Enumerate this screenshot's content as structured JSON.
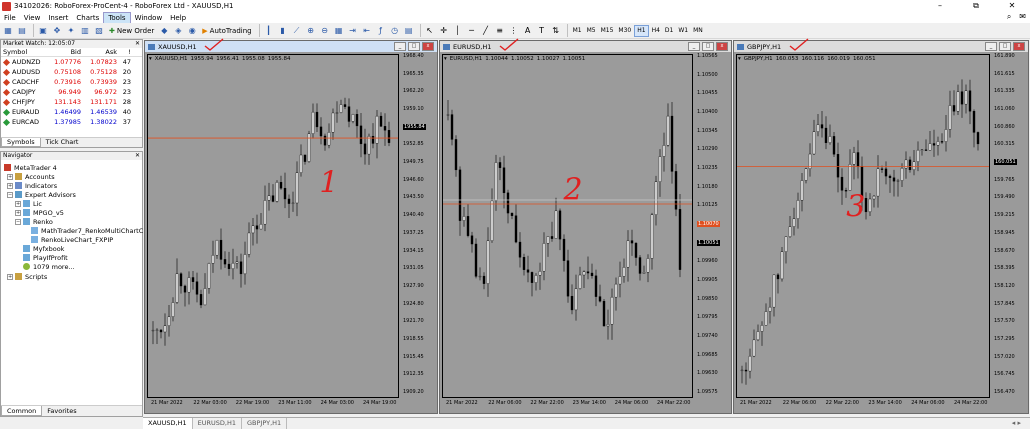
{
  "window": {
    "title": "34102026: RoboForex-ProCent-4 - RoboForex Ltd - XAUUSD,H1",
    "min_label": "–",
    "max_label": "⧉",
    "close_label": "✕"
  },
  "menu": [
    "File",
    "View",
    "Insert",
    "Charts",
    "Tools",
    "Window",
    "Help"
  ],
  "menu_active": "Tools",
  "toolbar": {
    "new_order": "New Order",
    "autotrading": "AutoTrading",
    "timeframes": [
      "M1",
      "M5",
      "M15",
      "M30",
      "H1",
      "H4",
      "D1",
      "W1",
      "MN"
    ],
    "active_timeframe": "H1"
  },
  "market_watch": {
    "title": "Market Watch: 12:05:07",
    "headers": [
      "Symbol",
      "Bid",
      "Ask",
      "!"
    ],
    "rows": [
      {
        "symbol": "AUDNZD",
        "bid": "1.07776",
        "ask": "1.07823",
        "spread": "47",
        "color": "red"
      },
      {
        "symbol": "AUDUSD",
        "bid": "0.75108",
        "ask": "0.75128",
        "spread": "20",
        "color": "red"
      },
      {
        "symbol": "CADCHF",
        "bid": "0.73916",
        "ask": "0.73939",
        "spread": "23",
        "color": "red"
      },
      {
        "symbol": "CADJPY",
        "bid": "96.949",
        "ask": "96.972",
        "spread": "23",
        "color": "red"
      },
      {
        "symbol": "CHFJPY",
        "bid": "131.143",
        "ask": "131.171",
        "spread": "28",
        "color": "red"
      },
      {
        "symbol": "EURAUD",
        "bid": "1.46499",
        "ask": "1.46539",
        "spread": "40",
        "color": "blue"
      },
      {
        "symbol": "EURCAD",
        "bid": "1.37985",
        "ask": "1.38022",
        "spread": "37",
        "color": "blue"
      }
    ],
    "tabs": [
      "Symbols",
      "Tick Chart"
    ]
  },
  "navigator": {
    "title": "Navigator",
    "root": "MetaTrader 4",
    "items": [
      "Accounts",
      "Indicators",
      "Expert Advisors",
      "Lic",
      "MPGO_v5",
      "Renko",
      "MathTrader7_RenkoMultiChartC",
      "RenkoLiveChart_FXPIP",
      "Myfxbook",
      "PlayIfProfit",
      "1079 more...",
      "Scripts"
    ],
    "tabs": [
      "Common",
      "Favorites"
    ]
  },
  "charts": [
    {
      "window_title": "XAUUSD,H1",
      "info": [
        "XAUUSD,H1",
        "1955.94",
        "1956.41",
        "1955.08",
        "1955.84"
      ],
      "y_ticks": [
        "1968.40",
        "1965.35",
        "1962.20",
        "1959.10",
        "1955.84",
        "1952.85",
        "1949.75",
        "1946.60",
        "1943.50",
        "1940.40",
        "1937.25",
        "1934.15",
        "1931.05",
        "1927.90",
        "1924.80",
        "1921.70",
        "1918.55",
        "1915.45",
        "1912.35",
        "1909.20"
      ],
      "current_price": "1955.84",
      "x_ticks": [
        "21 Mar 2022",
        "22 Mar 03:00",
        "22 Mar 19:00",
        "23 Mar 11:00",
        "24 Mar 03:00",
        "24 Mar 19:00"
      ],
      "annotation": "1"
    },
    {
      "window_title": "EURUSD,H1",
      "info": [
        "EURUSD,H1",
        "1.10044",
        "1.10052",
        "1.10027",
        "1.10051"
      ],
      "y_ticks": [
        "1.10565",
        "1.10500",
        "1.10455",
        "1.10400",
        "1.10345",
        "1.10290",
        "1.10235",
        "1.10180",
        "1.10125",
        "1.10070",
        "1.10051",
        "1.09960",
        "1.09905",
        "1.09850",
        "1.09795",
        "1.09740",
        "1.09685",
        "1.09630",
        "1.09575"
      ],
      "current_price": "1.10051",
      "ask_price": "1.10070",
      "x_ticks": [
        "21 Mar 2022",
        "22 Mar 06:00",
        "22 Mar 22:00",
        "23 Mar 14:00",
        "24 Mar 06:00",
        "24 Mar 22:00"
      ],
      "annotation": "2"
    },
    {
      "window_title": "GBPJPY,H1",
      "info": [
        "GBPJPY,H1",
        "160.053",
        "160.116",
        "160.019",
        "160.051"
      ],
      "y_ticks": [
        "161.890",
        "161.615",
        "161.335",
        "161.060",
        "160.860",
        "160.315",
        "160.051",
        "159.765",
        "159.490",
        "159.215",
        "158.945",
        "158.670",
        "158.395",
        "158.120",
        "157.845",
        "157.570",
        "157.295",
        "157.020",
        "156.745",
        "156.470"
      ],
      "current_price": "160.051",
      "x_ticks": [
        "21 Mar 2022",
        "22 Mar 06:00",
        "22 Mar 22:00",
        "23 Mar 14:00",
        "24 Mar 06:00",
        "24 Mar 22:00"
      ],
      "annotation": "3"
    }
  ],
  "bottom_tabs": [
    "XAUUSD,H1",
    "EURUSD,H1",
    "GBPJPY,H1"
  ],
  "bottom_tab_active": "XAUUSD,H1",
  "colors": {
    "chart_bg": "#9b9b9b",
    "price_line": "#e05020",
    "candle": "#000000",
    "annotation": "#e02020"
  }
}
